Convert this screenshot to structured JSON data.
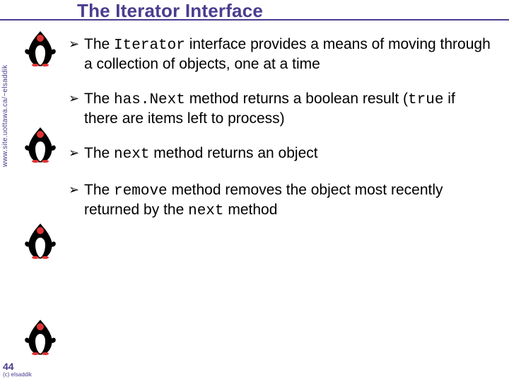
{
  "title": "The Iterator Interface",
  "side_url": "www.site.uottawa.ca/~elsaddik",
  "bullets": {
    "b1_pre": "The ",
    "b1_code": "Iterator",
    "b1_post": " interface provides a means of moving through a collection of objects, one at a time",
    "b2_pre": "The ",
    "b2_code1": "has.Next",
    "b2_mid": " method returns a boolean result (",
    "b2_code2": "true",
    "b2_post": " if there are items left to process)",
    "b3_pre": "The ",
    "b3_code": "next",
    "b3_post": " method returns an object",
    "b4_pre": "The ",
    "b4_code1": "remove",
    "b4_mid": " method removes the object most recently returned by the ",
    "b4_code2": "next",
    "b4_post": " method"
  },
  "page_number": "44",
  "copyright": "(c) elsaddik"
}
